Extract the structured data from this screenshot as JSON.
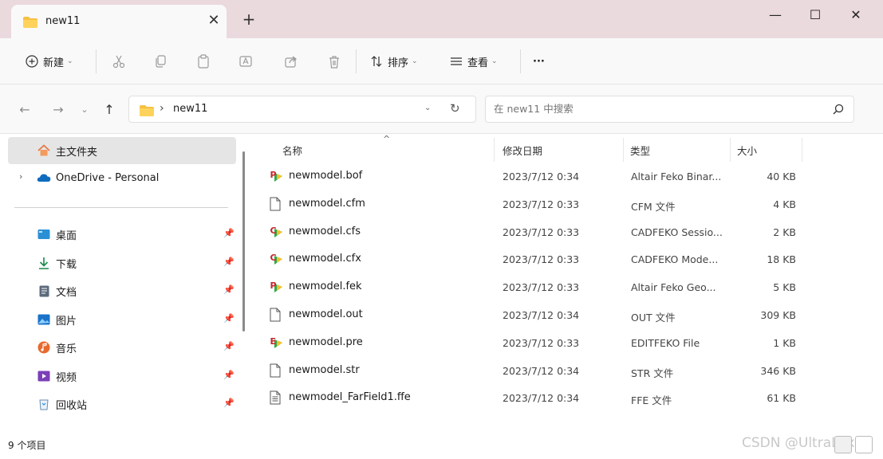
{
  "window": {
    "tab_title": "new11",
    "tab_close": "✕",
    "new_tab": "+",
    "minimize": "—",
    "maximize": "☐",
    "close": "✕"
  },
  "toolbar": {
    "new_label": "新建",
    "sort_label": "排序",
    "view_label": "查看",
    "more_label": "···"
  },
  "address": {
    "path": "new11",
    "search_placeholder": "在 new11 中搜索"
  },
  "sidebar": {
    "home": "主文件夹",
    "onedrive": "OneDrive - Personal",
    "quick": [
      {
        "label": "桌面",
        "icon": "desktop-icon"
      },
      {
        "label": "下载",
        "icon": "download-icon"
      },
      {
        "label": "文档",
        "icon": "documents-icon"
      },
      {
        "label": "图片",
        "icon": "pictures-icon"
      },
      {
        "label": "音乐",
        "icon": "music-icon"
      },
      {
        "label": "视频",
        "icon": "video-icon"
      },
      {
        "label": "回收站",
        "icon": "recycle-bin-icon"
      }
    ]
  },
  "columns": {
    "name": "名称",
    "modified": "修改日期",
    "type": "类型",
    "size": "大小"
  },
  "files": [
    {
      "name": "newmodel.bof",
      "date": "2023/7/12 0:34",
      "type": "Altair Feko Binar...",
      "size": "40 KB",
      "icon": "feko-p"
    },
    {
      "name": "newmodel.cfm",
      "date": "2023/7/12 0:33",
      "type": "CFM 文件",
      "size": "4 KB",
      "icon": "blank"
    },
    {
      "name": "newmodel.cfs",
      "date": "2023/7/12 0:33",
      "type": "CADFEKO Sessio...",
      "size": "2 KB",
      "icon": "feko-c"
    },
    {
      "name": "newmodel.cfx",
      "date": "2023/7/12 0:33",
      "type": "CADFEKO Mode...",
      "size": "18 KB",
      "icon": "feko-c"
    },
    {
      "name": "newmodel.fek",
      "date": "2023/7/12 0:33",
      "type": "Altair Feko Geo...",
      "size": "5 KB",
      "icon": "feko-p"
    },
    {
      "name": "newmodel.out",
      "date": "2023/7/12 0:34",
      "type": "OUT 文件",
      "size": "309 KB",
      "icon": "blank"
    },
    {
      "name": "newmodel.pre",
      "date": "2023/7/12 0:33",
      "type": "EDITFEKO File",
      "size": "1 KB",
      "icon": "feko-e"
    },
    {
      "name": "newmodel.str",
      "date": "2023/7/12 0:34",
      "type": "STR 文件",
      "size": "346 KB",
      "icon": "blank"
    },
    {
      "name": "newmodel_FarField1.ffe",
      "date": "2023/7/12 0:34",
      "type": "FFE 文件",
      "size": "61 KB",
      "icon": "text"
    }
  ],
  "status": {
    "count": "9 个项目",
    "watermark": "CSDN @UltraLext"
  }
}
